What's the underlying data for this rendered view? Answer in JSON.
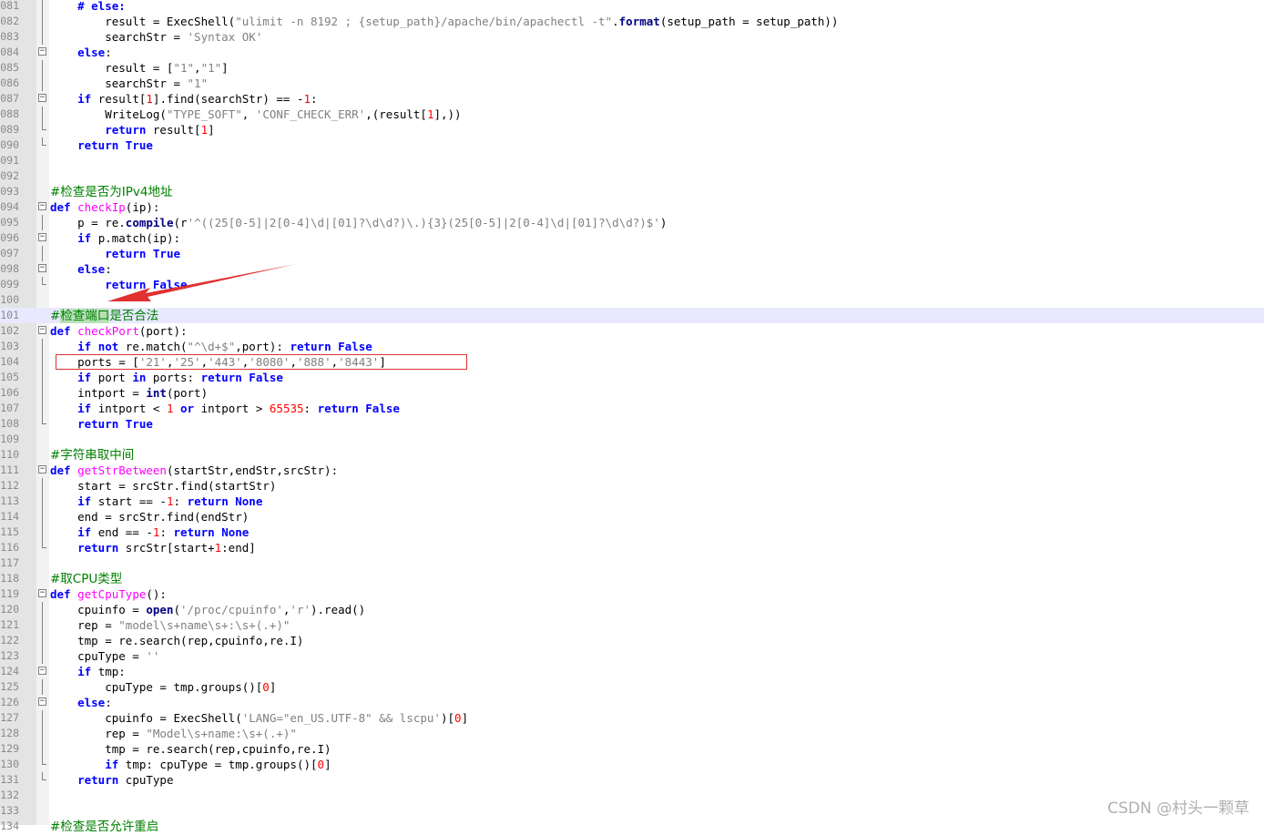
{
  "editor": {
    "lines": [
      {
        "n": "081",
        "fold": "line",
        "segs": [
          [
            "    ",
            ""
          ],
          [
            "# else:",
            "kw"
          ]
        ]
      },
      {
        "n": "082",
        "fold": "line",
        "segs": [
          [
            "        result = ExecShell(",
            ""
          ],
          [
            "\"ulimit -n 8192 ; {setup_path}/apache/bin/apachectl -t\"",
            "str"
          ],
          [
            ".",
            ""
          ],
          [
            "format",
            "fnb"
          ],
          [
            "(setup_path = setup_path))",
            ""
          ]
        ]
      },
      {
        "n": "083",
        "fold": "line",
        "segs": [
          [
            "        searchStr = ",
            ""
          ],
          [
            "'Syntax OK'",
            "str"
          ]
        ]
      },
      {
        "n": "084",
        "fold": "box",
        "segs": [
          [
            "    ",
            ""
          ],
          [
            "else",
            "kw"
          ],
          [
            ":",
            ""
          ]
        ]
      },
      {
        "n": "085",
        "fold": "line",
        "segs": [
          [
            "        result = [",
            ""
          ],
          [
            "\"1\"",
            "str"
          ],
          [
            ",",
            ""
          ],
          [
            "\"1\"",
            "str"
          ],
          [
            "]",
            ""
          ]
        ]
      },
      {
        "n": "086",
        "fold": "line",
        "segs": [
          [
            "        searchStr = ",
            ""
          ],
          [
            "\"1\"",
            "str"
          ]
        ]
      },
      {
        "n": "087",
        "fold": "box",
        "segs": [
          [
            "    ",
            ""
          ],
          [
            "if",
            "kw"
          ],
          [
            " result[",
            ""
          ],
          [
            "1",
            "num"
          ],
          [
            "].find(searchStr) == -",
            ""
          ],
          [
            "1",
            "num"
          ],
          [
            ":",
            ""
          ]
        ]
      },
      {
        "n": "088",
        "fold": "line",
        "segs": [
          [
            "        WriteLog(",
            ""
          ],
          [
            "\"TYPE_SOFT\"",
            "str"
          ],
          [
            ", ",
            ""
          ],
          [
            "'CONF_CHECK_ERR'",
            "str"
          ],
          [
            ",(result[",
            ""
          ],
          [
            "1",
            "num"
          ],
          [
            "],))",
            ""
          ]
        ]
      },
      {
        "n": "089",
        "fold": "end",
        "segs": [
          [
            "        ",
            ""
          ],
          [
            "return",
            "kw"
          ],
          [
            " result[",
            ""
          ],
          [
            "1",
            "num"
          ],
          [
            "]",
            ""
          ]
        ]
      },
      {
        "n": "090",
        "fold": "end",
        "segs": [
          [
            "    ",
            ""
          ],
          [
            "return",
            "kw"
          ],
          [
            " ",
            ""
          ],
          [
            "True",
            "kw"
          ]
        ]
      },
      {
        "n": "091",
        "fold": "",
        "segs": []
      },
      {
        "n": "092",
        "fold": "",
        "segs": []
      },
      {
        "n": "093",
        "fold": "",
        "segs": [
          [
            "#检查是否为IPv4地址",
            "cmt"
          ]
        ]
      },
      {
        "n": "094",
        "fold": "box",
        "segs": [
          [
            "def",
            "kw"
          ],
          [
            " ",
            ""
          ],
          [
            "checkIp",
            "fn"
          ],
          [
            "(ip):",
            ""
          ]
        ]
      },
      {
        "n": "095",
        "fold": "line",
        "segs": [
          [
            "    p = re.",
            ""
          ],
          [
            "compile",
            "fnb"
          ],
          [
            "(r",
            ""
          ],
          [
            "'^((25[0-5]|2[0-4]\\d|[01]?\\d\\d?)\\.){3}(25[0-5]|2[0-4]\\d|[01]?\\d\\d?)$'",
            "str"
          ],
          [
            ")",
            ""
          ]
        ]
      },
      {
        "n": "096",
        "fold": "box",
        "segs": [
          [
            "    ",
            ""
          ],
          [
            "if",
            "kw"
          ],
          [
            " p.match(ip):",
            ""
          ]
        ]
      },
      {
        "n": "097",
        "fold": "line",
        "segs": [
          [
            "        ",
            ""
          ],
          [
            "return",
            "kw"
          ],
          [
            " ",
            ""
          ],
          [
            "True",
            "kw"
          ]
        ]
      },
      {
        "n": "098",
        "fold": "box",
        "segs": [
          [
            "    ",
            ""
          ],
          [
            "else",
            "kw"
          ],
          [
            ":",
            ""
          ]
        ]
      },
      {
        "n": "099",
        "fold": "end",
        "segs": [
          [
            "        ",
            ""
          ],
          [
            "return",
            "kw"
          ],
          [
            " ",
            ""
          ],
          [
            "False",
            "kw"
          ]
        ]
      },
      {
        "n": "100",
        "fold": "",
        "segs": []
      },
      {
        "n": "101",
        "fold": "",
        "hl": true,
        "segs": [
          [
            "#",
            "cmt"
          ],
          [
            "检查端口",
            "cmt cmt-hl"
          ],
          [
            "是否合法",
            "cmt"
          ]
        ]
      },
      {
        "n": "102",
        "fold": "box",
        "segs": [
          [
            "def",
            "kw"
          ],
          [
            " ",
            ""
          ],
          [
            "checkPort",
            "fn"
          ],
          [
            "(port):",
            ""
          ]
        ]
      },
      {
        "n": "103",
        "fold": "line",
        "segs": [
          [
            "    ",
            ""
          ],
          [
            "if",
            "kw"
          ],
          [
            " ",
            ""
          ],
          [
            "not",
            "kw"
          ],
          [
            " re.match(",
            ""
          ],
          [
            "\"^\\d+$\"",
            "str"
          ],
          [
            ",port): ",
            ""
          ],
          [
            "return",
            "kw"
          ],
          [
            " ",
            ""
          ],
          [
            "False",
            "kw"
          ]
        ]
      },
      {
        "n": "104",
        "fold": "line",
        "segs": [
          [
            "    ports = [",
            ""
          ],
          [
            "'21'",
            "str"
          ],
          [
            ",",
            ""
          ],
          [
            "'25'",
            "str"
          ],
          [
            ",",
            ""
          ],
          [
            "'443'",
            "str"
          ],
          [
            ",",
            ""
          ],
          [
            "'8080'",
            "str"
          ],
          [
            ",",
            ""
          ],
          [
            "'888'",
            "str"
          ],
          [
            ",",
            ""
          ],
          [
            "'8443'",
            "str"
          ],
          [
            "]",
            ""
          ]
        ]
      },
      {
        "n": "105",
        "fold": "line",
        "segs": [
          [
            "    ",
            ""
          ],
          [
            "if",
            "kw"
          ],
          [
            " port ",
            ""
          ],
          [
            "in",
            "kw"
          ],
          [
            " ports: ",
            ""
          ],
          [
            "return",
            "kw"
          ],
          [
            " ",
            ""
          ],
          [
            "False",
            "kw"
          ]
        ]
      },
      {
        "n": "106",
        "fold": "line",
        "segs": [
          [
            "    intport = ",
            ""
          ],
          [
            "int",
            "fnb"
          ],
          [
            "(port)",
            ""
          ]
        ]
      },
      {
        "n": "107",
        "fold": "line",
        "segs": [
          [
            "    ",
            ""
          ],
          [
            "if",
            "kw"
          ],
          [
            " intport < ",
            ""
          ],
          [
            "1",
            "num"
          ],
          [
            " ",
            ""
          ],
          [
            "or",
            "kw"
          ],
          [
            " intport > ",
            ""
          ],
          [
            "65535",
            "num"
          ],
          [
            ": ",
            ""
          ],
          [
            "return",
            "kw"
          ],
          [
            " ",
            ""
          ],
          [
            "False",
            "kw"
          ]
        ]
      },
      {
        "n": "108",
        "fold": "end",
        "segs": [
          [
            "    ",
            ""
          ],
          [
            "return",
            "kw"
          ],
          [
            " ",
            ""
          ],
          [
            "True",
            "kw"
          ]
        ]
      },
      {
        "n": "109",
        "fold": "",
        "segs": []
      },
      {
        "n": "110",
        "fold": "",
        "segs": [
          [
            "#字符串取中间",
            "cmt"
          ]
        ]
      },
      {
        "n": "111",
        "fold": "box",
        "segs": [
          [
            "def",
            "kw"
          ],
          [
            " ",
            ""
          ],
          [
            "getStrBetween",
            "fn"
          ],
          [
            "(startStr,endStr,srcStr):",
            ""
          ]
        ]
      },
      {
        "n": "112",
        "fold": "line",
        "segs": [
          [
            "    start = srcStr.find(startStr)",
            ""
          ]
        ]
      },
      {
        "n": "113",
        "fold": "line",
        "segs": [
          [
            "    ",
            ""
          ],
          [
            "if",
            "kw"
          ],
          [
            " start == -",
            ""
          ],
          [
            "1",
            "num"
          ],
          [
            ": ",
            ""
          ],
          [
            "return",
            "kw"
          ],
          [
            " ",
            ""
          ],
          [
            "None",
            "kw"
          ]
        ]
      },
      {
        "n": "114",
        "fold": "line",
        "segs": [
          [
            "    end = srcStr.find(endStr)",
            ""
          ]
        ]
      },
      {
        "n": "115",
        "fold": "line",
        "segs": [
          [
            "    ",
            ""
          ],
          [
            "if",
            "kw"
          ],
          [
            " end == -",
            ""
          ],
          [
            "1",
            "num"
          ],
          [
            ": ",
            ""
          ],
          [
            "return",
            "kw"
          ],
          [
            " ",
            ""
          ],
          [
            "None",
            "kw"
          ]
        ]
      },
      {
        "n": "116",
        "fold": "end",
        "segs": [
          [
            "    ",
            ""
          ],
          [
            "return",
            "kw"
          ],
          [
            " srcStr[start+",
            ""
          ],
          [
            "1",
            "num"
          ],
          [
            ":end]",
            ""
          ]
        ]
      },
      {
        "n": "117",
        "fold": "",
        "segs": []
      },
      {
        "n": "118",
        "fold": "",
        "segs": [
          [
            "#取CPU类型",
            "cmt"
          ]
        ]
      },
      {
        "n": "119",
        "fold": "box",
        "segs": [
          [
            "def",
            "kw"
          ],
          [
            " ",
            ""
          ],
          [
            "getCpuType",
            "fn"
          ],
          [
            "():",
            ""
          ]
        ]
      },
      {
        "n": "120",
        "fold": "line",
        "segs": [
          [
            "    cpuinfo = ",
            ""
          ],
          [
            "open",
            "fnb"
          ],
          [
            "(",
            ""
          ],
          [
            "'/proc/cpuinfo'",
            "str"
          ],
          [
            ",",
            ""
          ],
          [
            "'r'",
            "str"
          ],
          [
            ").read()",
            ""
          ]
        ]
      },
      {
        "n": "121",
        "fold": "line",
        "segs": [
          [
            "    rep = ",
            ""
          ],
          [
            "\"model\\s+name\\s+:\\s+(.+)\"",
            "str"
          ]
        ]
      },
      {
        "n": "122",
        "fold": "line",
        "segs": [
          [
            "    tmp = re.search(rep,cpuinfo,re.I)",
            ""
          ]
        ]
      },
      {
        "n": "123",
        "fold": "line",
        "segs": [
          [
            "    cpuType = ",
            ""
          ],
          [
            "''",
            "str"
          ]
        ]
      },
      {
        "n": "124",
        "fold": "box",
        "segs": [
          [
            "    ",
            ""
          ],
          [
            "if",
            "kw"
          ],
          [
            " tmp:",
            ""
          ]
        ]
      },
      {
        "n": "125",
        "fold": "line",
        "segs": [
          [
            "        cpuType = tmp.groups()[",
            ""
          ],
          [
            "0",
            "num"
          ],
          [
            "]",
            ""
          ]
        ]
      },
      {
        "n": "126",
        "fold": "box",
        "segs": [
          [
            "    ",
            ""
          ],
          [
            "else",
            "kw"
          ],
          [
            ":",
            ""
          ]
        ]
      },
      {
        "n": "127",
        "fold": "line",
        "segs": [
          [
            "        cpuinfo = ExecShell(",
            ""
          ],
          [
            "'LANG=\"en_US.UTF-8\" && lscpu'",
            "str"
          ],
          [
            ")[",
            ""
          ],
          [
            "0",
            "num"
          ],
          [
            "]",
            ""
          ]
        ]
      },
      {
        "n": "128",
        "fold": "line",
        "segs": [
          [
            "        rep = ",
            ""
          ],
          [
            "\"Model\\s+name:\\s+(.+)\"",
            "str"
          ]
        ]
      },
      {
        "n": "129",
        "fold": "line",
        "segs": [
          [
            "        tmp = re.search(rep,cpuinfo,re.I)",
            ""
          ]
        ]
      },
      {
        "n": "130",
        "fold": "end",
        "segs": [
          [
            "        ",
            ""
          ],
          [
            "if",
            "kw"
          ],
          [
            " tmp: cpuType = tmp.groups()[",
            ""
          ],
          [
            "0",
            "num"
          ],
          [
            "]",
            ""
          ]
        ]
      },
      {
        "n": "131",
        "fold": "end",
        "segs": [
          [
            "    ",
            ""
          ],
          [
            "return",
            "kw"
          ],
          [
            " cpuType",
            ""
          ]
        ]
      },
      {
        "n": "132",
        "fold": "",
        "segs": []
      },
      {
        "n": "133",
        "fold": "",
        "segs": []
      },
      {
        "n": "134",
        "fold": "",
        "segs": [
          [
            "#检查是否允许重启",
            "cmt"
          ]
        ]
      }
    ]
  },
  "watermark": "CSDN @村头一颗草",
  "colors": {
    "annotation": "#e03030",
    "keyword": "#0000ff",
    "comment": "#008000"
  }
}
